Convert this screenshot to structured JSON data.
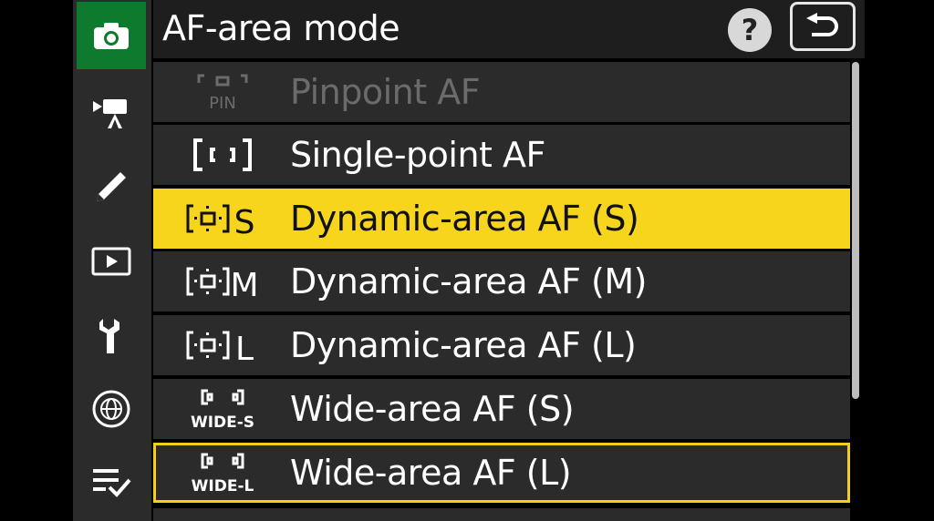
{
  "header": {
    "title": "AF-area mode",
    "help_label": "?",
    "back_icon": "return-icon"
  },
  "sidebar": {
    "tabs": [
      {
        "icon": "camera-icon",
        "active": true
      },
      {
        "icon": "movie-camera-icon",
        "active": false
      },
      {
        "icon": "pencil-icon",
        "active": false
      },
      {
        "icon": "playback-icon",
        "active": false
      },
      {
        "icon": "wrench-icon",
        "active": false
      },
      {
        "icon": "network-globe-icon",
        "active": false
      },
      {
        "icon": "my-menu-icon",
        "active": false
      }
    ]
  },
  "menu": {
    "items": [
      {
        "label": "Pinpoint AF",
        "icon": "pinpoint-af-icon",
        "icon_text": "PIN",
        "state": "disabled"
      },
      {
        "label": "Single-point AF",
        "icon": "single-point-af-icon",
        "state": "normal"
      },
      {
        "label": "Dynamic-area AF (S)",
        "icon": "dynamic-area-af-icon",
        "icon_text": "S",
        "state": "selected"
      },
      {
        "label": "Dynamic-area AF (M)",
        "icon": "dynamic-area-af-icon",
        "icon_text": "M",
        "state": "normal"
      },
      {
        "label": "Dynamic-area AF (L)",
        "icon": "dynamic-area-af-icon",
        "icon_text": "L",
        "state": "normal"
      },
      {
        "label": "Wide-area AF (S)",
        "icon": "wide-area-af-icon",
        "icon_text": "WIDE-S",
        "state": "normal"
      },
      {
        "label": "Wide-area AF (L)",
        "icon": "wide-area-af-icon",
        "icon_text": "WIDE-L",
        "state": "outlined"
      }
    ]
  },
  "colors": {
    "accent_yellow": "#f7d51d",
    "active_tab_green": "#0e7a2e",
    "row_background": "#2b2b2b",
    "disabled_text": "#6b6b6b"
  }
}
